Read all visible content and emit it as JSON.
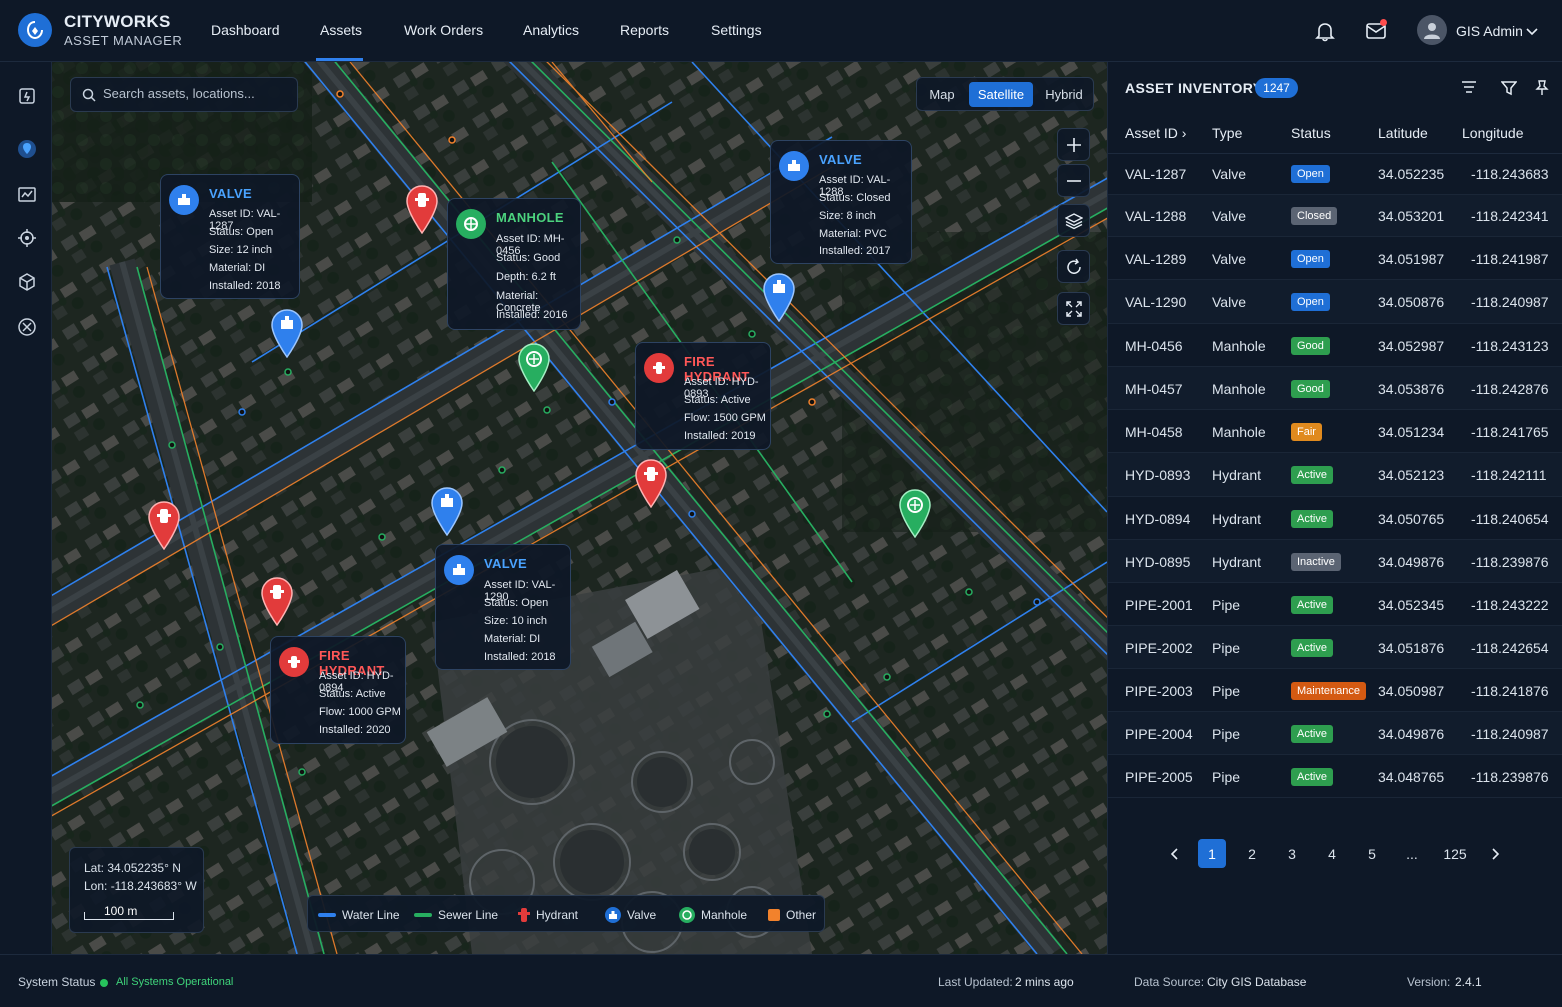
{
  "app": {
    "brand_line1": "CITYWORKS",
    "brand_line2": "ASSET MANAGER"
  },
  "nav": {
    "items": [
      "Dashboard",
      "Assets",
      "Work Orders",
      "Analytics",
      "Reports",
      "Settings"
    ],
    "active": "Assets"
  },
  "user": {
    "name": "GIS Admin"
  },
  "search": {
    "placeholder": "Search assets, locations..."
  },
  "map_types": {
    "options": [
      "Map",
      "Satellite",
      "Hybrid"
    ],
    "active": "Satellite"
  },
  "popups": [
    {
      "type": "valve",
      "title": "VALVE",
      "lines": [
        "Asset ID: VAL-1287",
        "Status: Open",
        "Size: 12 inch",
        "Material: DI",
        "Installed: 2018"
      ]
    },
    {
      "type": "manhole",
      "title": "MANHOLE",
      "lines": [
        "Asset ID: MH-0456",
        "Status: Good",
        "Depth: 6.2 ft",
        "Material: Concrete",
        "Installed: 2016"
      ]
    },
    {
      "type": "valve",
      "title": "VALVE",
      "lines": [
        "Asset ID: VAL-1288",
        "Status: Closed",
        "Size: 8 inch",
        "Material: PVC",
        "Installed: 2017"
      ]
    },
    {
      "type": "hydrant",
      "title": "FIRE HYDRANT",
      "lines": [
        "Asset ID: HYD-0893",
        "Status: Active",
        "Flow: 1500 GPM",
        "Installed: 2019"
      ]
    },
    {
      "type": "valve",
      "title": "VALVE",
      "lines": [
        "Asset ID: VAL-1290",
        "Status: Open",
        "Size: 10 inch",
        "Material: DI",
        "Installed: 2018"
      ]
    },
    {
      "type": "hydrant",
      "title": "FIRE HYDRANT",
      "lines": [
        "Asset ID: HYD-0894",
        "Status: Active",
        "Flow: 1000 GPM",
        "Installed: 2020"
      ]
    }
  ],
  "coords": {
    "lat": "Lat: 34.052235° N",
    "lon": "Lon: -118.243683° W",
    "scale": "100 m"
  },
  "legend": [
    "Water Line",
    "Sewer Line",
    "Hydrant",
    "Valve",
    "Manhole",
    "Other"
  ],
  "colors": {
    "accent": "#1f6fd6",
    "water": "#2f80ed",
    "sewer": "#27ae60",
    "hydrant": "#e23b3b",
    "other": "#f2822c"
  },
  "inventory": {
    "title": "ASSET INVENTORY",
    "count": "1247",
    "columns": [
      "Asset ID",
      "Type",
      "Status",
      "Latitude",
      "Longitude"
    ],
    "rows": [
      {
        "id": "VAL-1287",
        "type": "Valve",
        "status": "Open",
        "lat": "34.052235",
        "lon": "-118.243683"
      },
      {
        "id": "VAL-1288",
        "type": "Valve",
        "status": "Closed",
        "lat": "34.053201",
        "lon": "-118.242341"
      },
      {
        "id": "VAL-1289",
        "type": "Valve",
        "status": "Open",
        "lat": "34.051987",
        "lon": "-118.241987"
      },
      {
        "id": "VAL-1290",
        "type": "Valve",
        "status": "Open",
        "lat": "34.050876",
        "lon": "-118.240987"
      },
      {
        "id": "MH-0456",
        "type": "Manhole",
        "status": "Good",
        "lat": "34.052987",
        "lon": "-118.243123"
      },
      {
        "id": "MH-0457",
        "type": "Manhole",
        "status": "Good",
        "lat": "34.053876",
        "lon": "-118.242876"
      },
      {
        "id": "MH-0458",
        "type": "Manhole",
        "status": "Fair",
        "lat": "34.051234",
        "lon": "-118.241765"
      },
      {
        "id": "HYD-0893",
        "type": "Hydrant",
        "status": "Active",
        "lat": "34.052123",
        "lon": "-118.242111"
      },
      {
        "id": "HYD-0894",
        "type": "Hydrant",
        "status": "Active",
        "lat": "34.050765",
        "lon": "-118.240654"
      },
      {
        "id": "HYD-0895",
        "type": "Hydrant",
        "status": "Inactive",
        "lat": "34.049876",
        "lon": "-118.239876"
      },
      {
        "id": "PIPE-2001",
        "type": "Pipe",
        "status": "Active",
        "lat": "34.052345",
        "lon": "-118.243222"
      },
      {
        "id": "PIPE-2002",
        "type": "Pipe",
        "status": "Active",
        "lat": "34.051876",
        "lon": "-118.242654"
      },
      {
        "id": "PIPE-2003",
        "type": "Pipe",
        "status": "Maintenance",
        "lat": "34.050987",
        "lon": "-118.241876"
      },
      {
        "id": "PIPE-2004",
        "type": "Pipe",
        "status": "Active",
        "lat": "34.049876",
        "lon": "-118.240987"
      },
      {
        "id": "PIPE-2005",
        "type": "Pipe",
        "status": "Active",
        "lat": "34.048765",
        "lon": "-118.239876"
      }
    ],
    "status_colors": {
      "Open": "#1f6fd6",
      "Closed": "#5b6473",
      "Good": "#2e9e4f",
      "Fair": "#e08a1e",
      "Active": "#2e9e4f",
      "Inactive": "#5b6473",
      "Maintenance": "#d45a12"
    }
  },
  "pagination": {
    "pages": [
      "1",
      "2",
      "3",
      "4",
      "5",
      "...",
      "125"
    ],
    "active": "1"
  },
  "status_bar": {
    "label": "System Status",
    "status": "All Systems Operational",
    "last_updated_label": "Last Updated:",
    "last_updated": "2 mins ago",
    "source_label": "Data Source:",
    "source": "City GIS Database",
    "version_label": "Version:",
    "version": "2.4.1"
  }
}
